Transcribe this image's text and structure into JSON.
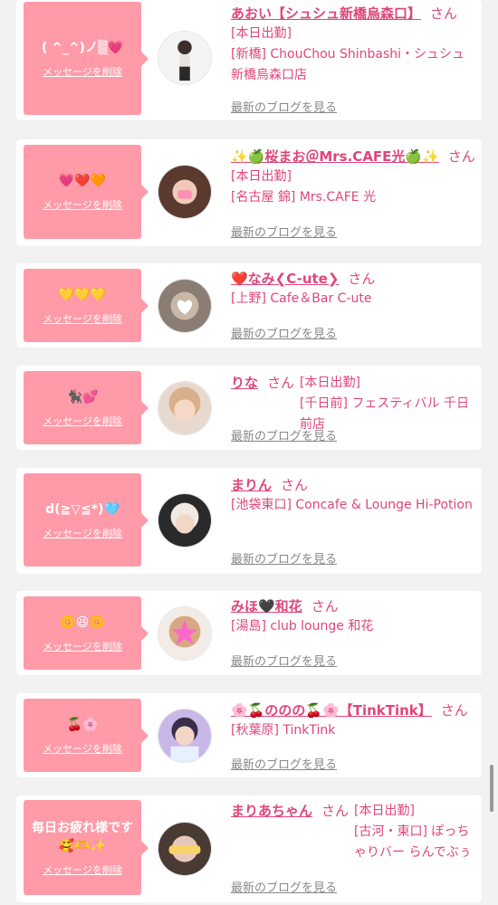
{
  "delete_label": "メッセージを削除",
  "blog_label": "最新のブログを見る",
  "san": "さん",
  "items": [
    {
      "message": "( ^_^)ノ▒💗",
      "name": "あおい【シュシュ新橋烏森口】",
      "shop": "[本日出勤]\n[新橋] ChouChou Shinbashi・シュシュ新橋烏森口店"
    },
    {
      "message": "💗❤️🧡",
      "name": "✨🍏桜まお＠Mrs.CAFE光🍏✨",
      "shop": "[本日出勤]\n[名古屋 錦] Mrs.CAFE 光"
    },
    {
      "message": "💛💛💛",
      "name": "❤️なみ❮C-ute❯",
      "shop": "[上野] Cafe＆Bar C-ute"
    },
    {
      "message": "🐈‍⬛💕",
      "name": "りな",
      "shop": "[本日出勤]\n[千日前] フェスティバル 千日前店"
    },
    {
      "message": "d(≧▽≦*)🩵",
      "name": "まりん",
      "shop": "[池袋東口] Concafe & Lounge Hi-Potion"
    },
    {
      "message": "🌼😆🌼",
      "name": "みほ🖤和花",
      "shop": "[湯島] club lounge 和花"
    },
    {
      "message": "🍒🌸",
      "name": "🌸🍒ののの🍒🌸【TinkTink】",
      "shop": "[秋葉原] TinkTink"
    },
    {
      "message": "毎日お疲れ様です\n🥰🫶✨",
      "name": "まりあちゃん",
      "shop": "[本日出勤]\n[古河・東口] ぽっちゃりバー らんでぶぅ"
    }
  ]
}
